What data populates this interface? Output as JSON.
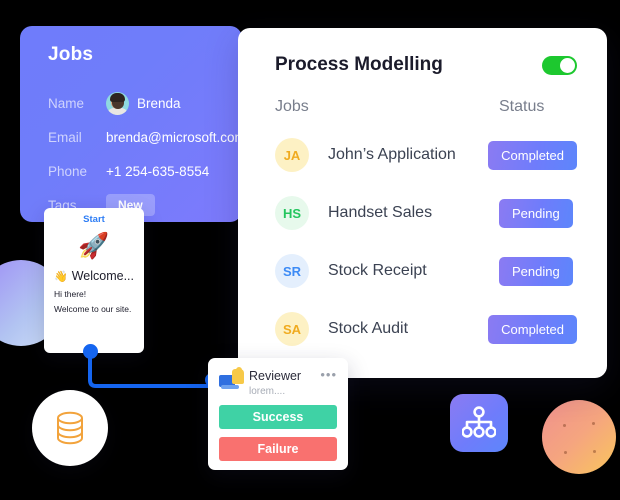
{
  "jobs_card": {
    "title": "Jobs",
    "rows": [
      {
        "label": "Name",
        "value": "Brenda",
        "icon": "user-avatar-photo"
      },
      {
        "label": "Email",
        "value": "brenda@microsoft.com",
        "icon": ""
      },
      {
        "label": "Phone",
        "value": "+1 254-635-8554",
        "icon": ""
      },
      {
        "label": "Tags",
        "value": "New",
        "icon": ""
      }
    ]
  },
  "process_card": {
    "title": "Process Modelling",
    "toggle": {
      "state": "on",
      "color": "#1dc82f"
    },
    "columns": {
      "jobs": "Jobs",
      "status": "Status"
    },
    "rows": [
      {
        "initials": "JA",
        "name": "John’s Application",
        "status": "Completed",
        "bg": "#fdf1c4",
        "fg": "#f0ab1f"
      },
      {
        "initials": "HS",
        "name": "Handset Sales",
        "status": "Pending",
        "bg": "#e7f9ec",
        "fg": "#23c55e"
      },
      {
        "initials": "SR",
        "name": "Stock Receipt",
        "status": "Pending",
        "bg": "#e4effd",
        "fg": "#3d8bf5"
      },
      {
        "initials": "SA",
        "name": "Stock Audit",
        "status": "Completed",
        "bg": "#fdf1c4",
        "fg": "#f0ab1f"
      }
    ],
    "badge_color": "#6f7cfb"
  },
  "chat_card": {
    "start_label": "Start",
    "rocket_icon": "🚀",
    "wave_icon": "👋",
    "welcome_title": "Welcome...",
    "lines": [
      "Hi there!",
      "Welcome to our site."
    ]
  },
  "reviewer_card": {
    "title": "Reviewer",
    "subtitle": "lorem....",
    "menu": "•••",
    "success_label": "Success",
    "failure_label": "Failure",
    "success_color": "#3fd2a5",
    "failure_color": "#f9716f"
  },
  "decorations": {
    "database_icon": "database-cylinder-icon",
    "hierarchy_icon": "org-chart-icon",
    "purple_blob": "#9d8df5",
    "orange_blob": "#f5a57f"
  }
}
